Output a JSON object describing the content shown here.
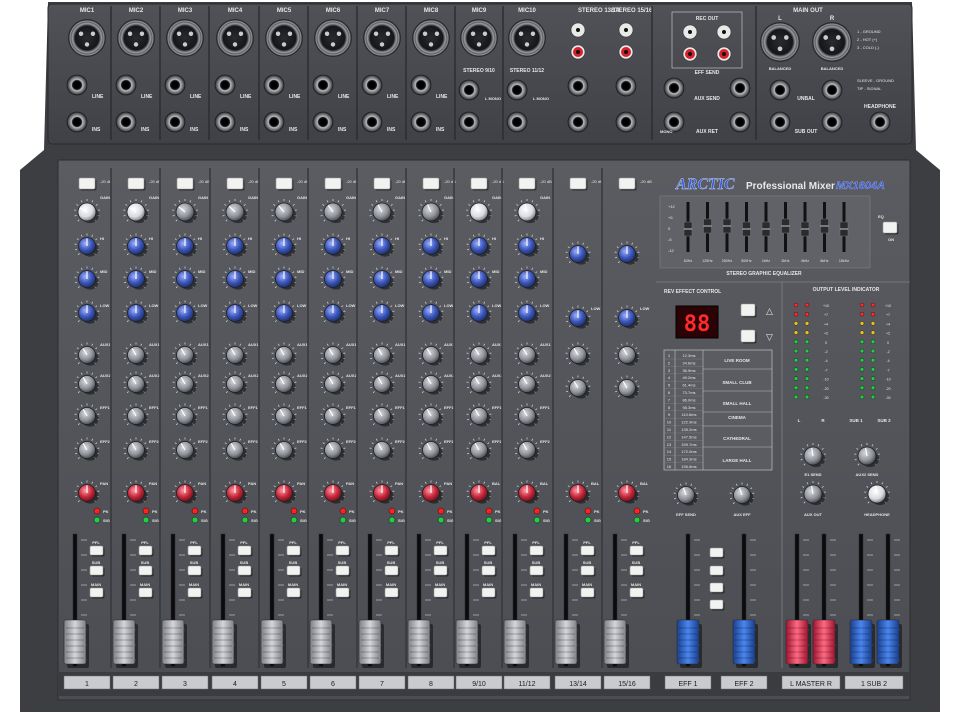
{
  "brand": {
    "logo": "ARCTIC",
    "product_name": "Professional Mixer",
    "model": "MX1604A"
  },
  "rear_panel": {
    "mic_labels": [
      "MIC1",
      "MIC2",
      "MIC3",
      "MIC4",
      "MIC5",
      "MIC6",
      "MIC7",
      "MIC8",
      "MIC9",
      "MIC10"
    ],
    "line_label": "LINE",
    "ins_label": "INS",
    "stereo_inputs": [
      {
        "label": "STEREO 9/10",
        "sublabel": "L MONO"
      },
      {
        "label": "STEREO 11/12",
        "sublabel": "L MONO"
      }
    ],
    "stereo_rca": [
      {
        "label": "STEREO 13/14"
      },
      {
        "label": "STEREO 15/16"
      }
    ],
    "rec_out_label": "REC OUT",
    "eff_send_label": "EFF SEND",
    "aux_send_label": "AUX SEND",
    "aux_ret_label": "AUX RET",
    "mono_label": "MONO",
    "main_out": {
      "label": "MAIN OUT",
      "left": "L",
      "right": "R",
      "balanced": "BALANCED",
      "pin_legend": [
        "1 - GROUND",
        "2 - HOT (+)",
        "3 - COLD (-)"
      ],
      "sleeve_legend": [
        "SLEEVE - GROUND",
        "TIP - SIGNAL"
      ]
    },
    "unbal_label": "UNBAL",
    "sub_out_label": "SUB OUT",
    "headphone_label": "HEADPHONE"
  },
  "channel_strip_labels": {
    "pad": "-20 dB",
    "gain": "GAIN",
    "hi": "HI",
    "mid": "MID",
    "low": "LOW",
    "aux1": "AUX1",
    "aux2": "AUX2",
    "eff1": "EFF1",
    "eff2": "EFF2",
    "pan": "PAN",
    "bal": "BAL",
    "pk": "PK",
    "sig": "SIG",
    "pfl": "PFL",
    "sub": "SUB",
    "main": "MAIN",
    "eq_range": "-15   +15dB"
  },
  "channels": [
    "1",
    "2",
    "3",
    "4",
    "5",
    "6",
    "7",
    "8",
    "9/10",
    "11/12",
    "13/14",
    "15/16"
  ],
  "graphic_eq": {
    "title": "STEREO GRAPHIC EQUALIZER",
    "bands": [
      "63Hz",
      "125Hz",
      "250Hz",
      "500Hz",
      "1kHz",
      "2kHz",
      "4kHz",
      "8kHz",
      "16kHz"
    ],
    "levels_db": [
      0,
      1,
      1,
      0,
      0,
      1,
      0,
      1,
      0
    ],
    "scale": [
      "+12",
      "+6",
      "0",
      "-6",
      "-12"
    ],
    "eq_button_label": "EQ",
    "on_label": "ON"
  },
  "effect_control": {
    "title": "REV EFFECT CONTROL",
    "display": "88",
    "presets": [
      {
        "num": "1",
        "time": "12.3ms"
      },
      {
        "num": "2",
        "time": "24.6ms"
      },
      {
        "num": "3",
        "time": "36.9ms"
      },
      {
        "num": "4",
        "time": "49.2ms"
      },
      {
        "num": "5",
        "time": "61.4ms"
      },
      {
        "num": "6",
        "time": "73.7ms"
      },
      {
        "num": "7",
        "time": "86.0ms"
      },
      {
        "num": "8",
        "time": "98.3ms"
      },
      {
        "num": "9",
        "time": "110.6ms"
      },
      {
        "num": "10",
        "time": "122.9ms"
      },
      {
        "num": "11",
        "time": "135.2ms"
      },
      {
        "num": "12",
        "time": "147.5ms"
      },
      {
        "num": "13",
        "time": "159.7ms"
      },
      {
        "num": "14",
        "time": "172.0ms"
      },
      {
        "num": "15",
        "time": "184.3ms"
      },
      {
        "num": "16",
        "time": "196.6ms"
      }
    ],
    "groups": [
      "LIVE ROOM",
      "SMALL CLUB",
      "SMALL HALL",
      "CINEMA",
      "CATHEDRAL",
      "LARGE HALL"
    ]
  },
  "meter": {
    "title": "OUTPUT LEVEL INDICATOR",
    "scale": [
      "+10",
      "+7",
      "+4",
      "+2",
      "0",
      "-2",
      "-4",
      "-7",
      "-10",
      "-20",
      "-30"
    ],
    "labels": [
      "L",
      "R",
      "SUB 1",
      "SUB 2"
    ]
  },
  "master_section": {
    "eff_send": "EFF SEND",
    "aux_eff": "AUX EFF",
    "e1_send": "E1 SEND",
    "aux2_send": "AUX2 SEND",
    "aux_out": "AUX OUT",
    "headphone": "HEADPHONE"
  },
  "fader_strip": {
    "eff1": "EFF 1",
    "eff2": "EFF 2",
    "master": "L  MASTER  R",
    "sub": "1   SUB   2"
  },
  "colors": {
    "panel": "#55575c",
    "panel_top": "#4a4c51",
    "knob_gray": "#8e9298",
    "knob_blue": "#3a56b8",
    "knob_red": "#c8283a",
    "fader_gray": "#b6b8bc",
    "fader_blue": "#2f62c6",
    "fader_red": "#e0304a",
    "led_red": "#ff2020",
    "led_green": "#22cc44"
  }
}
